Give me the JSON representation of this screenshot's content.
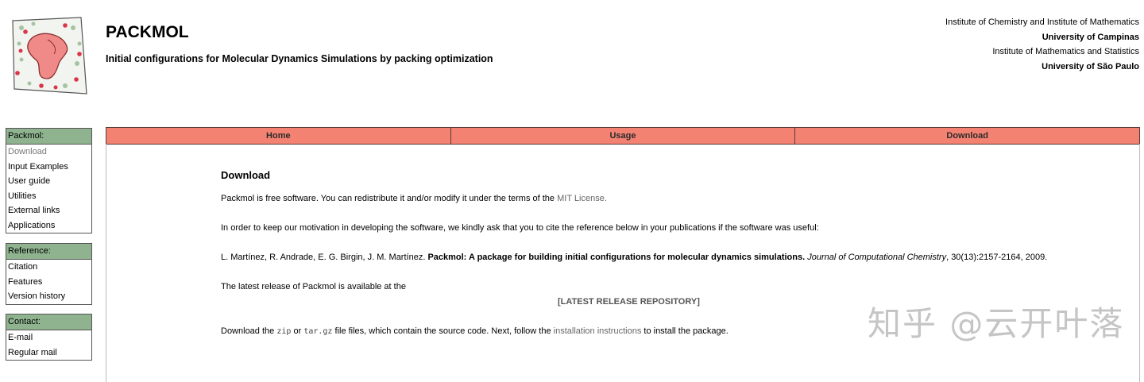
{
  "header": {
    "title": "PACKMOL",
    "subtitle": "Initial configurations for Molecular Dynamics Simulations by packing optimization",
    "institutions": [
      "Institute of Chemistry and Institute of Mathematics",
      "University of Campinas",
      "Institute of Mathematics and Statistics",
      "University of São Paulo"
    ]
  },
  "sidebar": {
    "packmol": {
      "heading": "Packmol:",
      "items": [
        "Download",
        "Input Examples",
        "User guide",
        "Utilities",
        "External links",
        "Applications"
      ]
    },
    "reference": {
      "heading": "Reference:",
      "items": [
        "Citation",
        "Features",
        "Version history"
      ]
    },
    "contact": {
      "heading": "Contact:",
      "items": [
        "E-mail",
        "Regular mail"
      ]
    }
  },
  "nav": {
    "tabs": [
      "Home",
      "Usage",
      "Download"
    ]
  },
  "content": {
    "title": "Download",
    "p1_text": "Packmol is free software. You can redistribute it and/or modify it under the terms of the",
    "p1_link": "MIT License.",
    "p2": "In order to keep our motivation in developing the software, we kindly ask that you to cite the reference below in your publications if the software was useful:",
    "citation": {
      "authors": "L. Martínez, R. Andrade, E. G. Birgin, J. M. Martínez.",
      "title": "Packmol: A package for building initial configurations for molecular dynamics simulations.",
      "journal": "Journal of Computational Chemistry",
      "details": ", 30(13):2157-2164, 2009."
    },
    "p3": "The latest release of Packmol is available at the",
    "repo_link": "[LATEST RELEASE REPOSITORY]",
    "p4": {
      "prefix": "Download the",
      "zip": "zip",
      "or": "or",
      "targz": "tar.gz",
      "middle": "file files, which contain the source code. Next, follow the",
      "link": "installation instructions",
      "suffix": "to install the package."
    }
  },
  "watermark": "知乎 @云开叶落"
}
